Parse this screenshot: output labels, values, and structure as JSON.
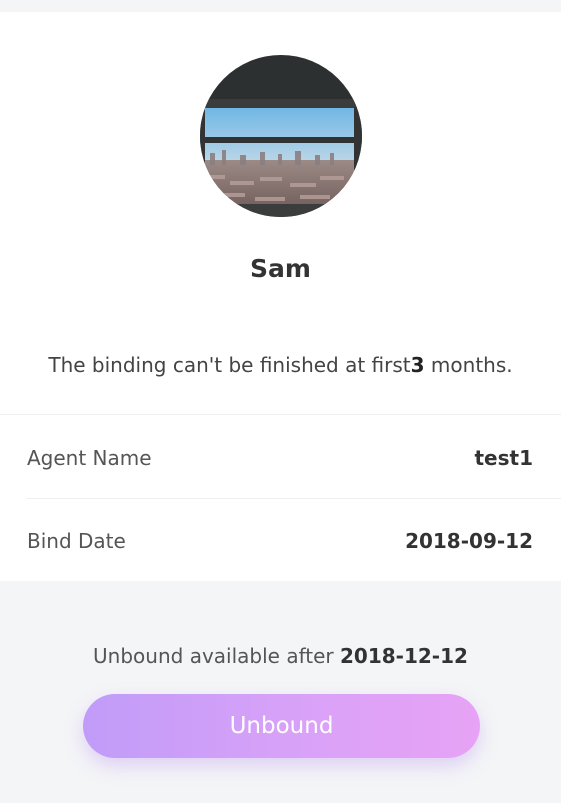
{
  "profile": {
    "name": "Sam",
    "avatar_icon": "city-window-photo"
  },
  "binding": {
    "note_prefix": "The binding can't be finished at first",
    "months": "3",
    "note_suffix": " months."
  },
  "details": [
    {
      "label": "Agent Name",
      "value": "test1"
    },
    {
      "label": "Bind Date",
      "value": "2018-09-12"
    }
  ],
  "unbound": {
    "note_prefix": "Unbound available after ",
    "date": "2018-12-12",
    "button_label": "Unbound"
  },
  "colors": {
    "background": "#f4f5f7",
    "card": "#ffffff",
    "button_gradient_start": "#c09cf8",
    "button_gradient_end": "#e7a3f5"
  }
}
